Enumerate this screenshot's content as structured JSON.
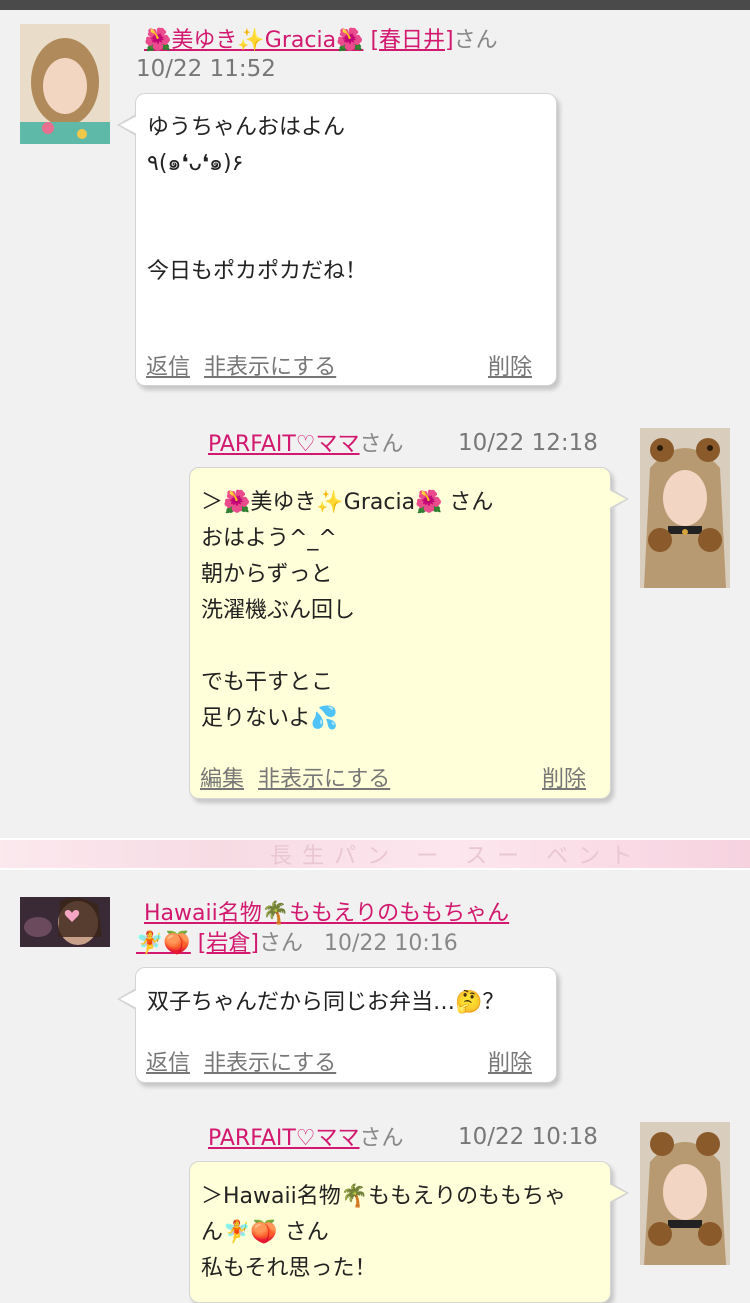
{
  "colors": {
    "link": "#d2186f",
    "bubble_white": "#ffffff",
    "bubble_yellow": "#ffffd9",
    "background": "#f1f1f1"
  },
  "banner": {
    "text": "長生パン ー スー ベント"
  },
  "posts": [
    {
      "author_name": "🌺美ゆき✨Gracia🌺",
      "location": "[春日井]",
      "san": "さん",
      "timestamp": "10/22 11:52",
      "body_lines": [
        "ゆうちゃんおはよん",
        "٩(๑❛ᴗ❛๑)۶",
        "",
        "",
        "今日もポカポカだね！"
      ],
      "actions": {
        "reply": "返信",
        "hide": "非表示にする",
        "delete": "削除"
      }
    },
    {
      "author_name": "PARFAIT♡ママ",
      "san": "さん",
      "timestamp": "10/22 12:18",
      "body_lines": [
        "＞🌺美ゆき✨Gracia🌺 さん",
        "おはよう^_^",
        "朝からずっと",
        "洗濯機ぶん回し",
        "",
        "でも干すとこ",
        "足りないよ💦"
      ],
      "actions": {
        "edit": "編集",
        "hide": "非表示にする",
        "delete": "削除"
      }
    },
    {
      "author_name": "Hawaii名物🌴ももえりのももちゃん",
      "author_name_cont": "🧚🍑",
      "location": "[岩倉]",
      "san": "さん",
      "timestamp": "10/22 10:16",
      "body_lines": [
        "双子ちゃんだから同じお弁当…🤔？"
      ],
      "actions": {
        "reply": "返信",
        "hide": "非表示にする",
        "delete": "削除"
      }
    },
    {
      "author_name": "PARFAIT♡ママ",
      "san": "さん",
      "timestamp": "10/22 10:18",
      "body_lines": [
        "＞Hawaii名物🌴ももえりのももちゃ",
        "ん🧚🍑 さん",
        "私もそれ思った！"
      ]
    }
  ]
}
